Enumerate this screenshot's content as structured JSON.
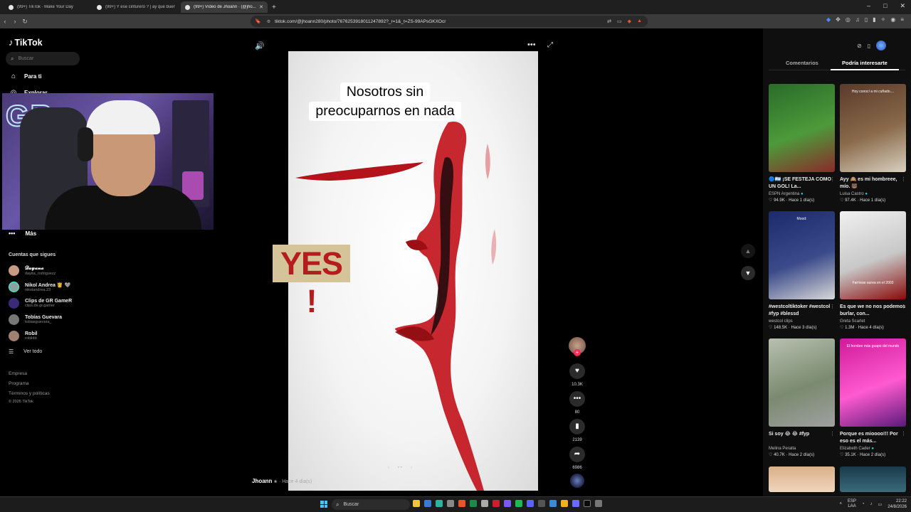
{
  "browser": {
    "tabs": [
      {
        "label": "(99+) TikTok · Make Your Day",
        "active": false
      },
      {
        "label": "(99+) Y ese cinturero ? | ay que bueno",
        "active": false
      },
      {
        "label": "(99+) Vídeo de Jhoann · (@jho...",
        "active": true
      }
    ],
    "url": "tiktok.com/@jhoann280/photo/7676253918011247892?_r=1&_t=ZS-99APsGKXOcr",
    "window_controls": [
      "–",
      "□",
      "✕"
    ]
  },
  "sidebar": {
    "logo": "TikTok",
    "search_placeholder": "Buscar",
    "nav": [
      {
        "label": "Para ti",
        "icon": "home-icon"
      },
      {
        "label": "Explorar",
        "icon": "compass-icon"
      }
    ],
    "more_label": "Más",
    "following_title": "Cuentas que sigues",
    "following": [
      {
        "name": "𝓓𝓪𝔂𝓪𝓷𝓪",
        "user": "dayita_rodriguezz",
        "color": "#c79a84"
      },
      {
        "name": "Nikol Andrea 👸 🩶",
        "user": "nikolandrea.23",
        "color": "#8aa3a0"
      },
      {
        "name": "Clips de GR GameR",
        "user": "clips.de.gr.gamer",
        "color": "#3b2a7a"
      },
      {
        "name": "Tobías Guevara",
        "user": "tobiasguevara_",
        "color": "#777777"
      },
      {
        "name": "Robil",
        "user": "robildd",
        "color": "#a08070"
      }
    ],
    "see_all": "Ver todo",
    "footer": [
      "Empresa",
      "Programa",
      "Términos y políticas",
      "© 2026 TikTok"
    ]
  },
  "video": {
    "caption_lines": [
      "Nosotros sin",
      "preocuparnos en nada"
    ],
    "sticker_text": "YES !",
    "author": "Jhoann",
    "author_badge": "❀",
    "posted": "· Hace 4 día(s)",
    "carousel_nav": [
      "‹",
      "• •",
      "›"
    ]
  },
  "actions": {
    "likes": "10.3K",
    "comments": "80",
    "saves": "2139",
    "shares": "6986"
  },
  "right_panel": {
    "tabs": [
      "Comentarios",
      "Podría interesarte"
    ],
    "active_tab": "Podría interesarte",
    "cards": [
      {
        "title": "🔵🇦🇷 ¡SE FESTEJA COMO UN GOL! La...",
        "author": "ESPN Argentina",
        "verified": true,
        "likes": "94.9K",
        "time": "Hace 1 día(s)",
        "thumb_colors": [
          "#2a6b2a",
          "#4d9a3a",
          "#8a2a2a"
        ],
        "overlay": ""
      },
      {
        "title": "Ayy 🙈 es mi hombreee, mío. 🐻",
        "author": "Luisa Castro",
        "verified": true,
        "likes": "97.4K",
        "time": "Hace 1 día(s)",
        "thumb_colors": [
          "#5a3a2a",
          "#8a6a4a",
          "#d8d0c0"
        ],
        "overlay": "Hoy conocí a mi cuñado...."
      },
      {
        "title": "#westcoltiktoker #westcol #fyp #blessd",
        "author": "westcol clips",
        "verified": false,
        "likes": "148.5K",
        "time": "Hace 3 día(s)",
        "thumb_colors": [
          "#1a2a6a",
          "#3a4a8a",
          "#d8d8d8"
        ],
        "overlay": "Mood:"
      },
      {
        "title": "Es que we no nos podemos burlar, con...",
        "author": "Greta Scarlet",
        "verified": false,
        "likes": "1.3M",
        "time": "Hace 4 día(s)",
        "thumb_colors": [
          "#f0f0f0",
          "#c8c8c8",
          "#8a0a0a"
        ],
        "overlay": "Farmear aurea en el 2003"
      },
      {
        "title": "Si soy 😂 😂 #fyp",
        "author": "Melina Peralta",
        "verified": false,
        "likes": "40.7K",
        "time": "Hace 2 día(s)",
        "thumb_colors": [
          "#b8c0b0",
          "#7a8a70",
          "#a0a0a0"
        ],
        "overlay": ""
      },
      {
        "title": "Porque es mioooo!!! Por eso es el más...",
        "author": "Elizabeth Cader",
        "verified": true,
        "likes": "35.1K",
        "time": "Hace 2 día(s)",
        "thumb_colors": [
          "#d01a9a",
          "#ff5ad0",
          "#5a1a7a"
        ],
        "overlay": "El hombre más guapo del mundo"
      }
    ]
  },
  "taskbar": {
    "search_label": "Buscar",
    "lang_line1": "ESP",
    "lang_line2": "LAA",
    "time": "22:22",
    "date": "24/8/2026"
  }
}
